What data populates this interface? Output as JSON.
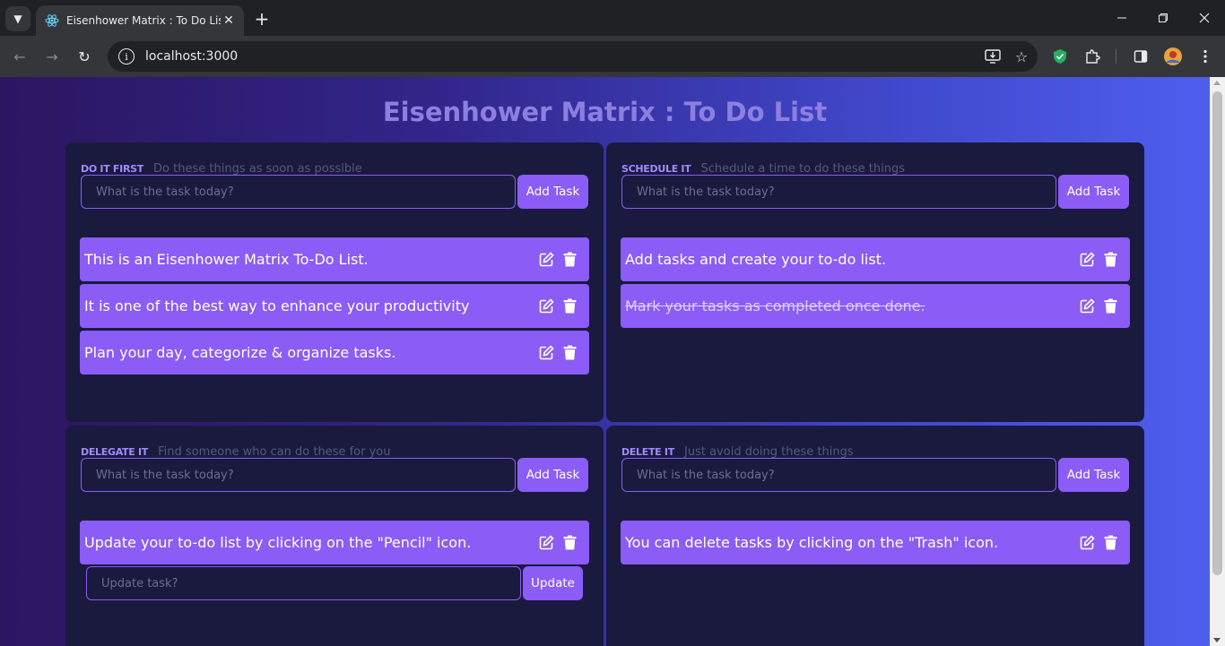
{
  "browser": {
    "tab_title": "Eisenhower Matrix : To Do List",
    "url": "localhost:3000",
    "icons": [
      "chevron-down-icon",
      "react-icon",
      "close-icon",
      "plus-icon",
      "back-icon",
      "forward-icon",
      "reload-icon",
      "info-icon",
      "install-icon",
      "star-icon",
      "shield-extension-icon",
      "puzzle-icon",
      "side-panel-icon",
      "profile-avatar",
      "more-icon",
      "minimize-icon",
      "restore-icon",
      "window-close-icon"
    ]
  },
  "page": {
    "title": "Eisenhower Matrix : To Do List",
    "accent_color": "#8b5cf6",
    "quadrants": [
      {
        "label": "DO IT FIRST",
        "description": "Do these things as soon as possible",
        "input_placeholder": "What is the task today?",
        "add_label": "Add Task",
        "tasks": [
          {
            "text": "This is an Eisenhower Matrix To-Do List.",
            "completed": false
          },
          {
            "text": "It is one of the best way to enhance your productivity",
            "completed": false
          },
          {
            "text": "Plan your day, categorize & organize tasks.",
            "completed": false
          }
        ]
      },
      {
        "label": "SCHEDULE IT",
        "description": "Schedule a time to do these things",
        "input_placeholder": "What is the task today?",
        "add_label": "Add Task",
        "tasks": [
          {
            "text": "Add tasks and create your to-do list.",
            "completed": false
          },
          {
            "text": "Mark your tasks as completed once done.",
            "completed": true
          }
        ]
      },
      {
        "label": "DELEGATE IT",
        "description": "Find someone who can do these for you",
        "input_placeholder": "What is the task today?",
        "add_label": "Add Task",
        "tasks": [
          {
            "text": "Update your to-do list by clicking on the \"Pencil\" icon.",
            "completed": false
          }
        ],
        "update_placeholder": "Update task?",
        "update_label": "Update"
      },
      {
        "label": "DELETE IT",
        "description": "Just avoid doing these things",
        "input_placeholder": "What is the task today?",
        "add_label": "Add Task",
        "tasks": [
          {
            "text": "You can delete tasks by clicking on the \"Trash\" icon.",
            "completed": false
          }
        ]
      }
    ]
  }
}
